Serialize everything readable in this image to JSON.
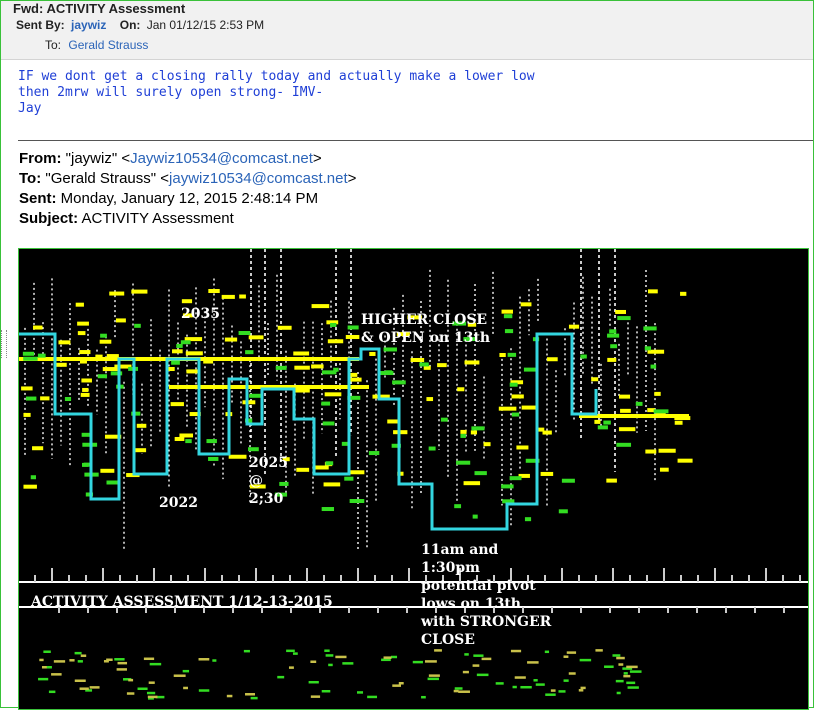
{
  "header": {
    "subject": "Fwd: ACTIVITY Assessment",
    "sent_by_label": "Sent By:",
    "sent_by": "jaywiz",
    "on_label": "On:",
    "on_value": "Jan 01/12/15 2:53 PM",
    "to_label": "To:",
    "to_value": "Gerald Strauss"
  },
  "message": {
    "lines": [
      "IF we dont get a closing rally today and actually make a lower low",
      "then 2mrw will surely open strong- IMV-",
      "Jay"
    ]
  },
  "forwarded": {
    "from_label": "From:",
    "from_name": "\"jaywiz\" <",
    "from_email": "Jaywiz10534@comcast.net",
    "from_end": ">",
    "to_label": "To:",
    "to_name": "\"Gerald Strauss\" <",
    "to_email": "jaywiz10534@comcast.net",
    "to_end": ">",
    "sent_label": "Sent:",
    "sent_value": "Monday, January 12, 2015 2:48:14 PM",
    "subject_label": "Subject:",
    "subject_value": "ACTIVITY Assessment"
  },
  "chart_image": {
    "annotations": {
      "label_2035": "2035",
      "higher_close": "HIGHER CLOSE\n& OPEN on 13th",
      "label_2025": "2025\n@\n2;30",
      "label_2022": "2022",
      "pivot_note": "11am and\n1:30pm\npotential pivot\nlows on 13th\nwith STRONGER\nCLOSE",
      "title": "ACTIVITY ASSESSMENT 1/12-13-2015"
    },
    "colors": {
      "background": "#000000",
      "cyan_line": "#33d6e0",
      "yellow": "#ffff00",
      "green": "#33dd22",
      "white": "#ffffff"
    }
  }
}
